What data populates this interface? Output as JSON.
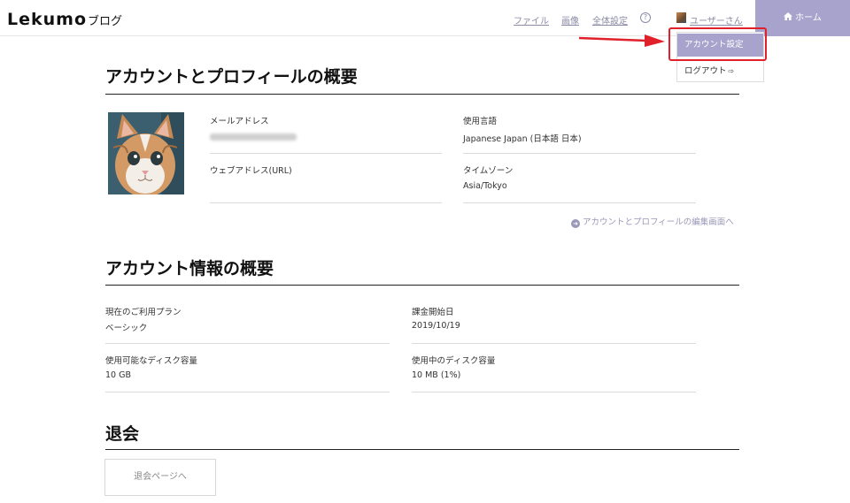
{
  "header": {
    "logo_main": "Lekumo",
    "logo_sub": "ブログ",
    "nav": {
      "files": "ファイル",
      "images": "画像",
      "global_settings": "全体設定",
      "help": "?"
    },
    "user_name": "ユーザーさん",
    "home_label": "ホーム"
  },
  "user_menu": {
    "account_settings": "アカウント設定",
    "logout": "ログアウト",
    "logout_icon": "⇨"
  },
  "profile_section": {
    "title": "アカウントとプロフィールの概要",
    "email_label": "メールアドレス",
    "url_label": "ウェブアドレス(URL)",
    "url_value": "",
    "language_label": "使用言語",
    "language_value": "Japanese Japan (日本語 日本)",
    "timezone_label": "タイムゾーン",
    "timezone_value": "Asia/Tokyo",
    "edit_link": "アカウントとプロフィールの編集画面へ"
  },
  "account_section": {
    "title": "アカウント情報の概要",
    "plan_label": "現在のご利用プラン",
    "plan_value": "ベーシック",
    "billing_start_label": "課金開始日",
    "billing_start_value": "2019/10/19",
    "disk_available_label": "使用可能なディスク容量",
    "disk_available_value": "10 GB",
    "disk_used_label": "使用中のディスク容量",
    "disk_used_value": "10 MB (1%)"
  },
  "withdraw_section": {
    "title": "退会",
    "button_label": "退会ページへ"
  },
  "colors": {
    "accent": "#a7a3cc",
    "annotation_red": "#e0202a",
    "link": "#8a8aa6"
  }
}
